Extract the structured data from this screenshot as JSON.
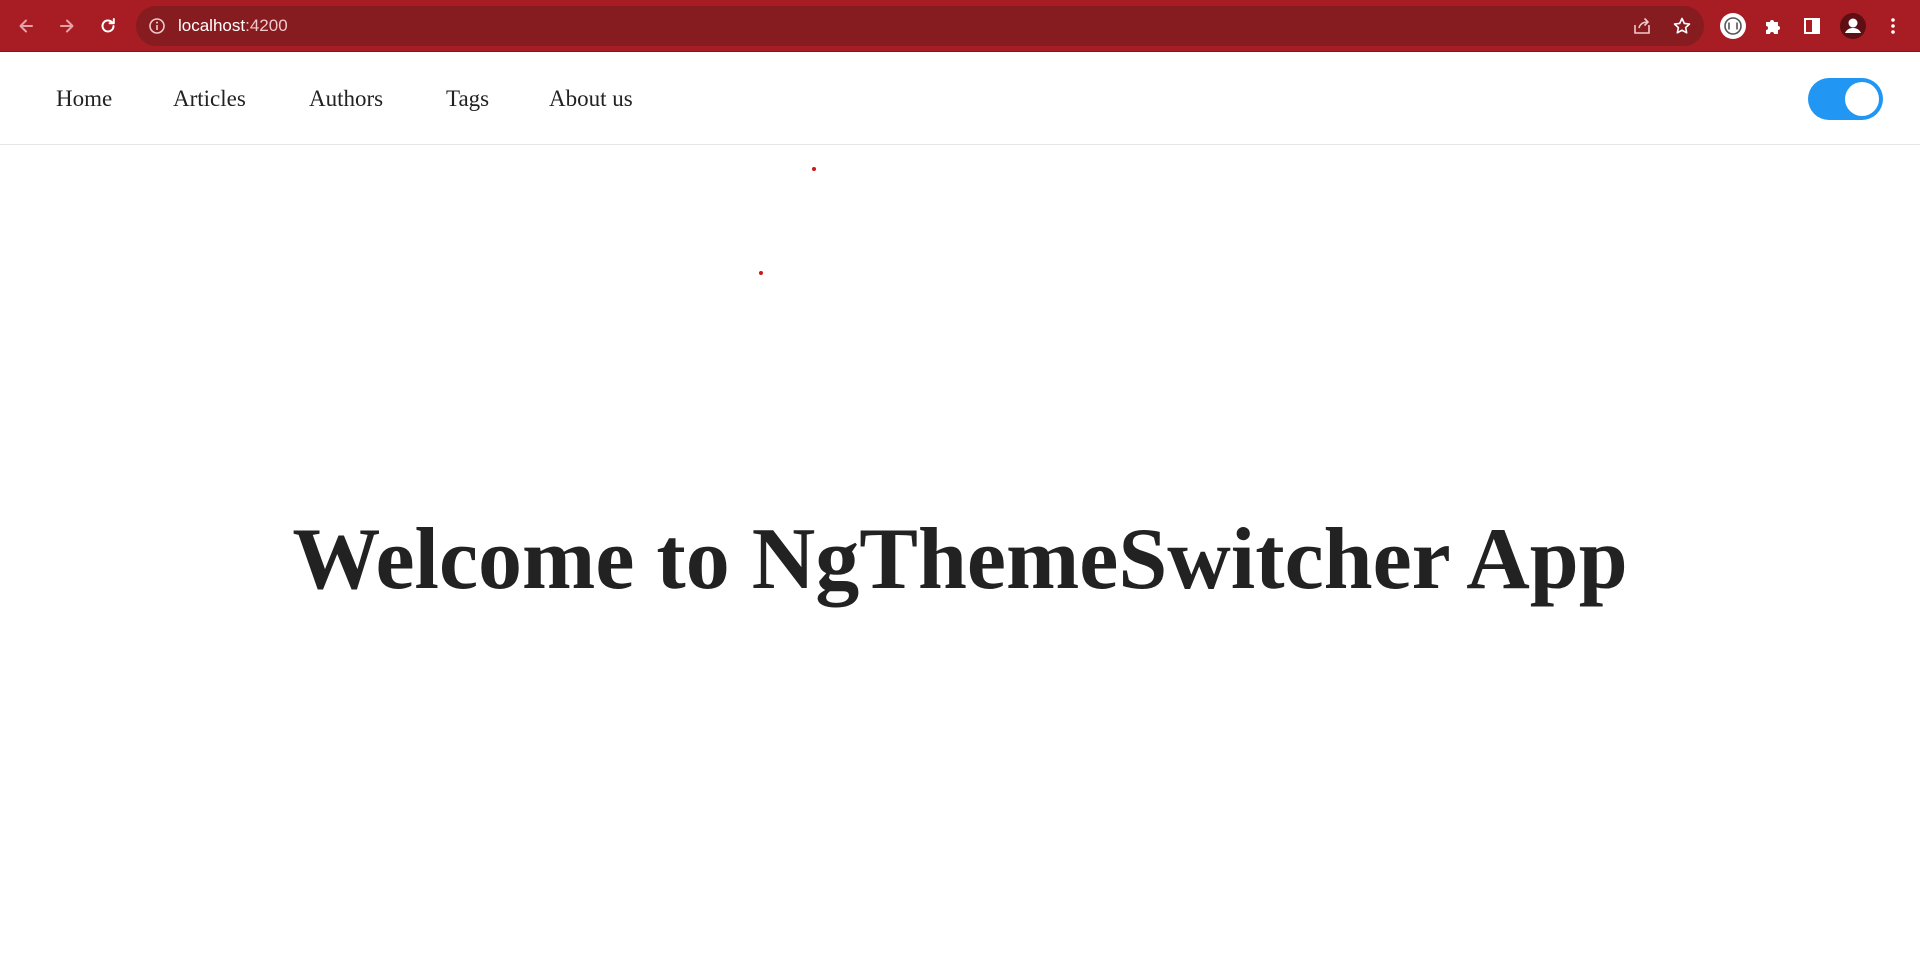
{
  "browser": {
    "url_host": "localhost",
    "url_port": ":4200",
    "icons": {
      "back": "back-arrow-icon",
      "forward": "forward-arrow-icon",
      "reload": "reload-icon",
      "info": "site-info-icon",
      "share": "share-icon",
      "bookmark": "star-icon",
      "extension_app": "extension-circle-icon",
      "extensions": "puzzle-icon",
      "side_panel": "side-panel-icon",
      "profile": "profile-icon",
      "menu": "kebab-menu-icon"
    }
  },
  "nav": {
    "items": [
      {
        "label": "Home"
      },
      {
        "label": "Articles"
      },
      {
        "label": "Authors"
      },
      {
        "label": "Tags"
      },
      {
        "label": "About us"
      }
    ],
    "theme_toggle_on": true
  },
  "main": {
    "heading": "Welcome to NgThemeSwitcher App"
  },
  "colors": {
    "toolbar": "#a81c24",
    "omnibox": "#861b20",
    "toggle": "#2196f3",
    "text": "#222222",
    "dot": "#d01616"
  }
}
